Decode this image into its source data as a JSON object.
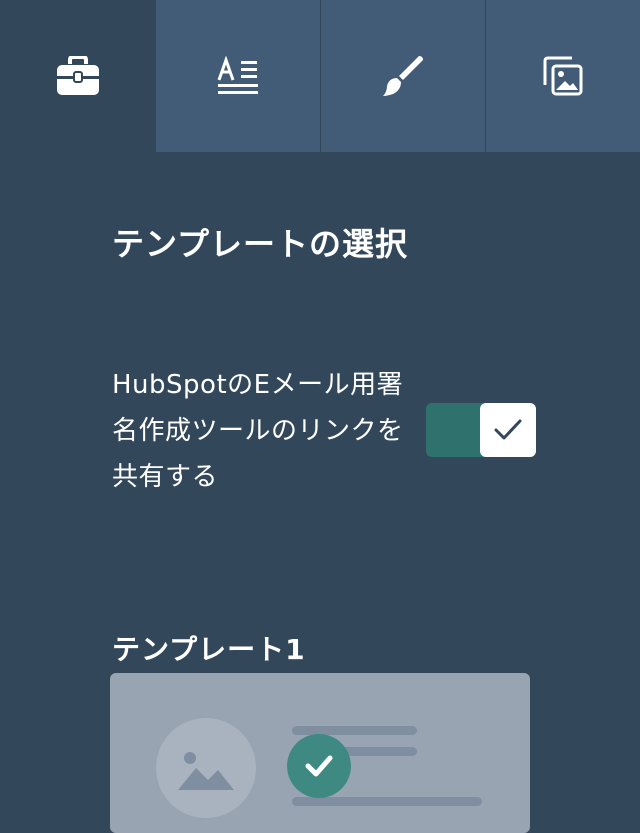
{
  "tabs": [
    {
      "icon": "toolbox-icon",
      "active": true
    },
    {
      "icon": "text-format-icon",
      "active": false
    },
    {
      "icon": "paintbrush-icon",
      "active": false
    },
    {
      "icon": "image-gallery-icon",
      "active": false
    }
  ],
  "section": {
    "title": "テンプレートの選択"
  },
  "toggle": {
    "label": "HubSpotのEメール用署名作成ツールのリンクを共有する",
    "checked": true,
    "on_color": "#2e716d"
  },
  "templates": [
    {
      "label": "テンプレート1",
      "selected": true
    }
  ],
  "colors": {
    "background": "#33475b",
    "tab_inactive": "#425b76",
    "accent": "#3e8a83",
    "card": "#99a4b2"
  }
}
